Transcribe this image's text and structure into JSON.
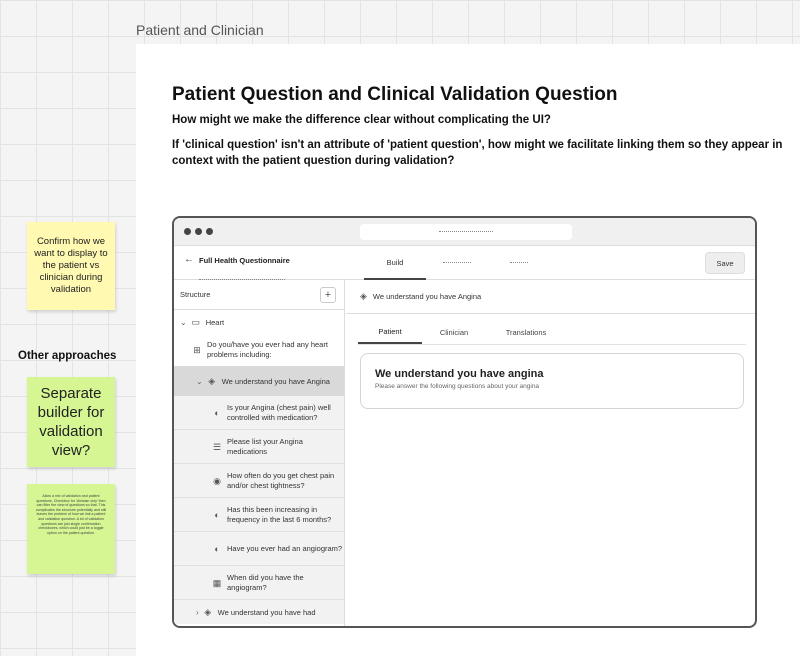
{
  "frame": {
    "label": "Patient and Clinician",
    "title": "Patient Question and Clinical Validation Question",
    "question1": "How might we make the difference clear without complicating the UI?",
    "question2": "If 'clinical question' isn't an attribute of 'patient question', how might we facilitate linking them so they appear in context with the patient question during validation?"
  },
  "stickies": {
    "note1": "Confirm how we want to display to the patient vs clinician during validation",
    "heading": "Other approaches",
    "note2": "Separate builder for validation view?",
    "note3": "Allow a mix of validation and patient questions. Checkbox for 'clinician only' then can filter the view of questions so that. This complicates the structure potentially and still leaves the problem of how we link a patient and validation question. A lot of validation questions are just single confirmation checkboxes, which could just be a toggle option on the patient question."
  },
  "app": {
    "title": "Full Health Questionnaire",
    "nav": [
      "Build"
    ],
    "save": "Save",
    "sidebar": {
      "title": "Structure",
      "section": "Heart",
      "question": "Do you/have you ever had any heart problems including:",
      "subsection": "We understand you have Angina",
      "items": [
        {
          "icon": "toggle-icon",
          "label": "Is your Angina (chest pain) well controlled with medication?"
        },
        {
          "icon": "list-icon",
          "label": "Please list your Angina medications"
        },
        {
          "icon": "radio-icon",
          "label": "How often do you get chest pain and/or chest tightness?"
        },
        {
          "icon": "toggle-icon",
          "label": "Has this been increasing in frequency in the last 6 months?"
        },
        {
          "icon": "toggle-icon",
          "label": "Have you ever had an angiogram?"
        },
        {
          "icon": "calendar-icon",
          "label": "When did you have the angiogram?"
        }
      ],
      "last": "We understand you have had"
    },
    "main": {
      "header": "We understand you have Angina",
      "tabs": [
        "Patient",
        "Clinician",
        "Translations"
      ],
      "card_title": "We understand you have angina",
      "card_sub": "Please answer the following questions about your angina"
    }
  }
}
